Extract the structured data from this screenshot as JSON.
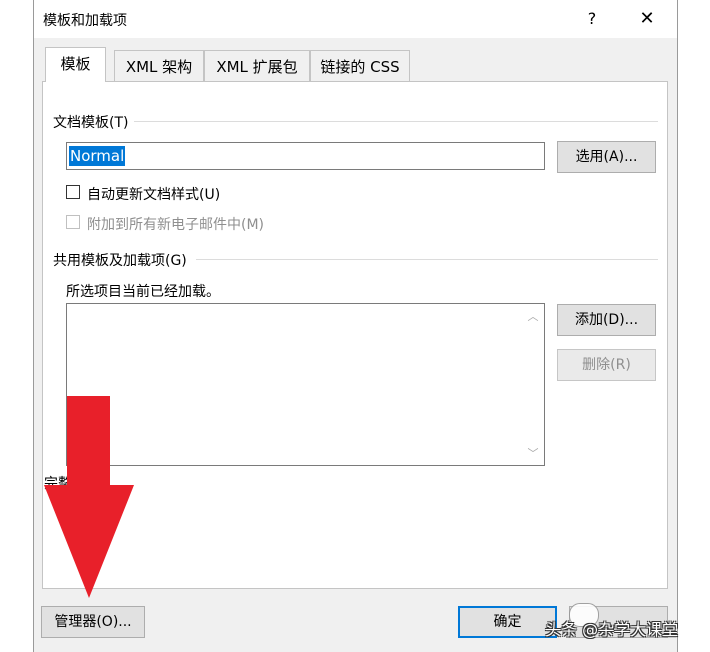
{
  "window": {
    "title": "模板和加载项",
    "help": "?",
    "close": "✕"
  },
  "tabs": [
    {
      "label": "模板",
      "active": true
    },
    {
      "label": "XML 架构"
    },
    {
      "label": "XML 扩展包"
    },
    {
      "label": "链接的 CSS"
    }
  ],
  "document_template": {
    "group_label": "文档模板(T)",
    "value": "Normal",
    "choose_button": "选用(A)..."
  },
  "options": {
    "auto_update": {
      "label": "自动更新文档样式(U)",
      "checked": false
    },
    "attach_to_email": {
      "label": "附加到所有新电子邮件中(M)",
      "checked": false,
      "disabled": true
    }
  },
  "global_templates": {
    "group_label": "共用模板及加载项(G)",
    "description": "所选项目当前已经加载。",
    "items": [],
    "add_button": "添加(D)...",
    "remove_button": "删除(R)",
    "full_path_label": "完整路径:"
  },
  "footer": {
    "organizer_button": "管理器(O)...",
    "ok_button": "确定"
  },
  "overlay": {
    "arrow_color": "#e8202a",
    "watermark": "头条 @杂学大课堂"
  }
}
